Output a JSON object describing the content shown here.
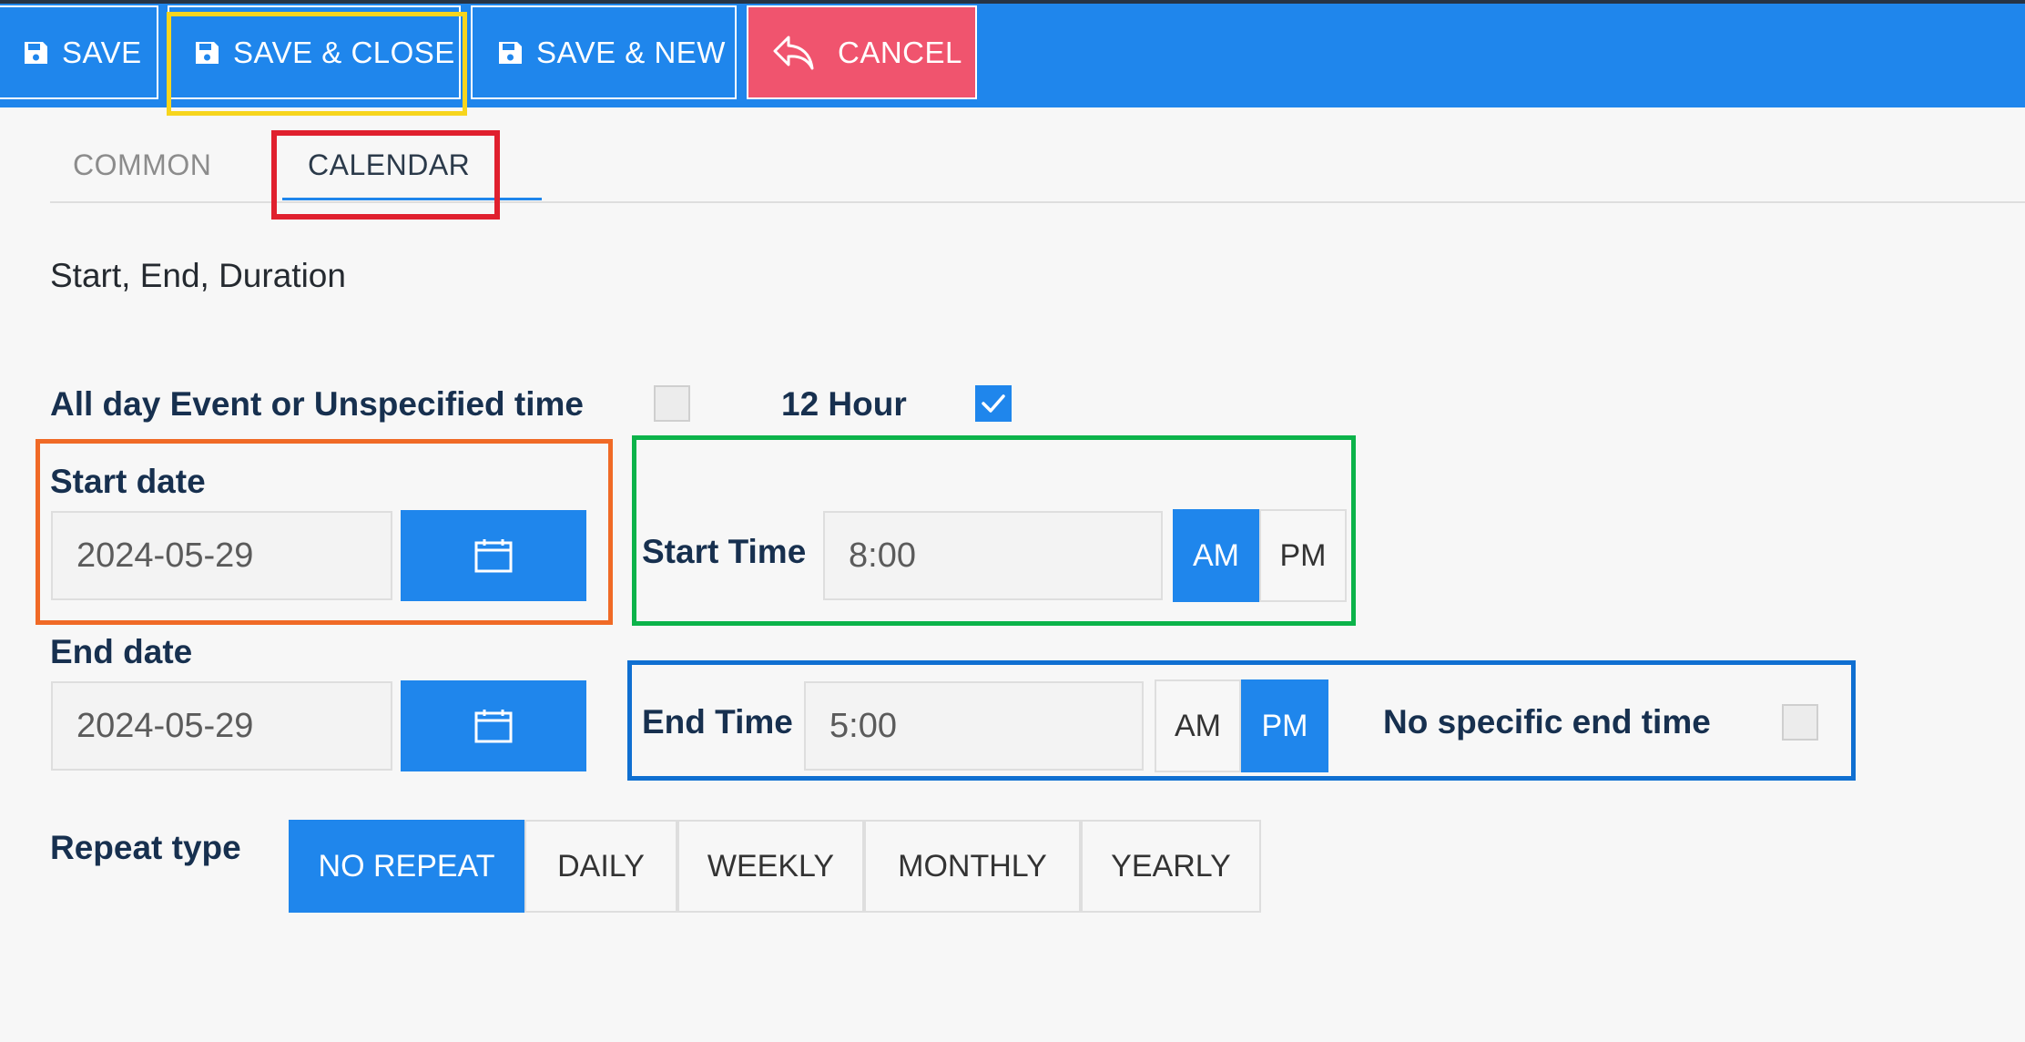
{
  "toolbar": {
    "save_label": "SAVE",
    "save_close_label": "SAVE & CLOSE",
    "save_new_label": "SAVE & NEW",
    "cancel_label": "CANCEL",
    "save_icon": "floppy-disk-icon",
    "cancel_icon": "reply-arrow-icon"
  },
  "tabs": [
    {
      "label": "COMMON",
      "active": false
    },
    {
      "label": "CALENDAR",
      "active": true
    }
  ],
  "section": {
    "title": "Start, End, Duration"
  },
  "options": {
    "all_day_label": "All day Event or Unspecified time",
    "all_day_checked": false,
    "twelve_hour_label": "12 Hour",
    "twelve_hour_checked": true
  },
  "start": {
    "date_label": "Start date",
    "date_value": "2024-05-29",
    "time_label": "Start Time",
    "time_value": "8:00",
    "am_label": "AM",
    "pm_label": "PM",
    "meridiem": "AM"
  },
  "end": {
    "date_label": "End date",
    "date_value": "2024-05-29",
    "time_label": "End Time",
    "time_value": "5:00",
    "am_label": "AM",
    "pm_label": "PM",
    "meridiem": "PM",
    "no_specific_label": "No specific end time",
    "no_specific_checked": false
  },
  "repeat": {
    "label": "Repeat type",
    "options": [
      "NO REPEAT",
      "DAILY",
      "WEEKLY",
      "MONTHLY",
      "YEARLY"
    ],
    "selected": "NO REPEAT"
  },
  "colors": {
    "primary": "#1f86ec",
    "cancel": "#f0546e",
    "highlight_yellow": "#f7d51d",
    "highlight_red": "#e0202e",
    "highlight_orange": "#f06a26",
    "highlight_green": "#0cb34a",
    "highlight_blue": "#0f6fd1"
  }
}
